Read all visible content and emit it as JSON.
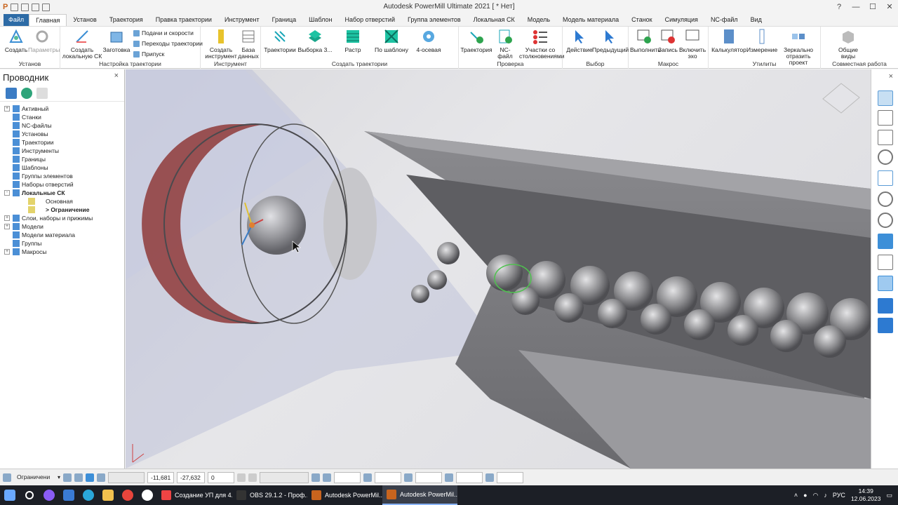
{
  "window": {
    "title": "Autodesk PowerMill Ultimate 2021   [ * Нет]"
  },
  "tabs": [
    "Файл",
    "Главная",
    "Установ",
    "Траектория",
    "Правка траектории",
    "Инструмент",
    "Граница",
    "Шаблон",
    "Набор отверстий",
    "Группа элементов",
    "Локальная СК",
    "Модель",
    "Модель материала",
    "Станок",
    "Симуляция",
    "NC-файл",
    "Вид"
  ],
  "ribbon": {
    "groups": {
      "setup": "Установ",
      "traj_setup": "Настройка траектории",
      "tool": "Инструмент",
      "create_traj": "Создать траектории",
      "check": "Проверка",
      "select": "Выбор",
      "macro": "Макрос",
      "utils": "Утилиты",
      "collab": "Совместная работа"
    },
    "buttons": {
      "create": "Создать",
      "params": "Параметры",
      "create_lcs": "Создать локальную СК",
      "block": "Заготовка",
      "feeds": "Подачи и скорости",
      "transitions": "Переходы траектории",
      "allowance": "Припуск",
      "create_tool": "Создать инструмент",
      "database": "База данных",
      "trajectories": "Траектории",
      "selection3": "Выборка 3...",
      "raster": "Растр",
      "by_template": "По шаблону",
      "four_axis": "4-осевая",
      "traj_check": "Траектория",
      "nc_check": "NC-файл",
      "collision": "Участки со столкновениями",
      "action": "Действие",
      "previous": "Предыдущий",
      "run": "Выполнить",
      "record": "Запись",
      "echo": "Включить эхо",
      "calculator": "Калькулятор",
      "measure": "Измерение",
      "mirror": "Зеркально отразить проект",
      "shared_views": "Общие виды"
    }
  },
  "explorer": {
    "title": "Проводник",
    "items": [
      {
        "label": "Активный",
        "level": 0,
        "exp": "+"
      },
      {
        "label": "Станки",
        "level": 0,
        "exp": ""
      },
      {
        "label": "NC-файлы",
        "level": 0,
        "exp": ""
      },
      {
        "label": "Установы",
        "level": 0,
        "exp": ""
      },
      {
        "label": "Траектории",
        "level": 0,
        "exp": ""
      },
      {
        "label": "Инструменты",
        "level": 0,
        "exp": ""
      },
      {
        "label": "Границы",
        "level": 0,
        "exp": ""
      },
      {
        "label": "Шаблоны",
        "level": 0,
        "exp": ""
      },
      {
        "label": "Группы элементов",
        "level": 0,
        "exp": ""
      },
      {
        "label": "Наборы отверстий",
        "level": 0,
        "exp": ""
      },
      {
        "label": "Локальные СК",
        "level": 0,
        "exp": "-",
        "bold": true
      },
      {
        "label": "Основная",
        "level": 1,
        "exp": ""
      },
      {
        "label": "> Ограничение",
        "level": 1,
        "exp": "",
        "bold": true
      },
      {
        "label": "Слои, наборы и прижимы",
        "level": 0,
        "exp": "+"
      },
      {
        "label": "Модели",
        "level": 0,
        "exp": "+"
      },
      {
        "label": "Модели материала",
        "level": 0,
        "exp": ""
      },
      {
        "label": "Группы",
        "level": 0,
        "exp": ""
      },
      {
        "label": "Макросы",
        "level": 0,
        "exp": "+"
      }
    ]
  },
  "status": {
    "workplane": "Ограничени",
    "x": "-11,681",
    "y": "-27,632",
    "z": "0"
  },
  "taskbar": {
    "apps": [
      {
        "label": "Создание УП для 4...",
        "color": "#e44"
      },
      {
        "label": "OBS 29.1.2 - Проф...",
        "color": "#333"
      },
      {
        "label": "Autodesk PowerMil...",
        "color": "#c8641e"
      },
      {
        "label": "Autodesk PowerMil...",
        "color": "#c8641e"
      }
    ],
    "lang": "РУС",
    "time": "14:39",
    "date": "12.06.2023"
  }
}
